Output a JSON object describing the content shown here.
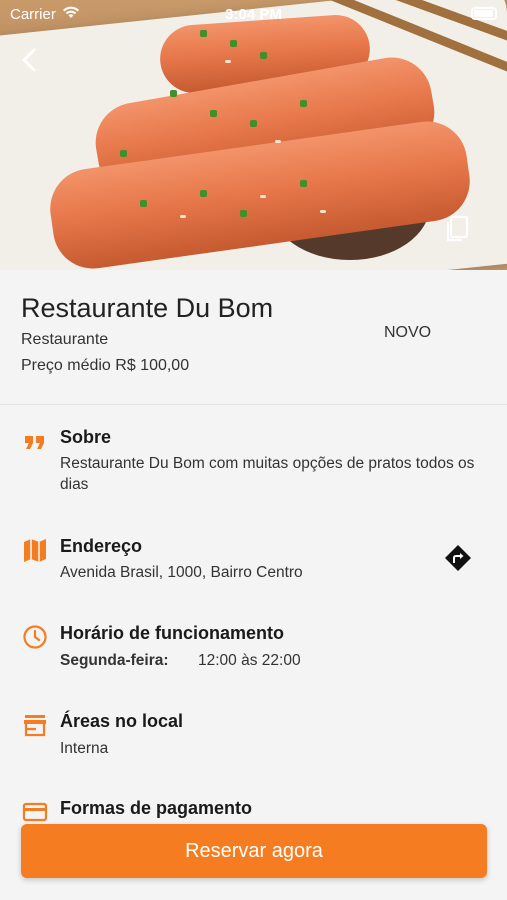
{
  "status_bar": {
    "carrier": "Carrier",
    "time": "3:04 PM"
  },
  "restaurant": {
    "name": "Restaurante Du Bom",
    "category": "Restaurante",
    "average_price": "Preço médio R$ 100,00",
    "badge": "NOVO"
  },
  "sections": {
    "about": {
      "title": "Sobre",
      "text": "Restaurante Du Bom com muitas opções de pratos todos os dias"
    },
    "address": {
      "title": "Endereço",
      "text": "Avenida Brasil, 1000, Bairro Centro"
    },
    "hours": {
      "title": "Horário de funcionamento",
      "day": "Segunda-feira:",
      "time": "12:00 às 22:00"
    },
    "areas": {
      "title": "Áreas no local",
      "text": "Interna"
    },
    "payment": {
      "title": "Formas de pagamento"
    }
  },
  "cta": {
    "label": "Reservar agora"
  },
  "icons": [
    "back-chevron-icon",
    "gallery-icon",
    "quote-icon",
    "map-icon",
    "directions-icon",
    "clock-icon",
    "store-icon",
    "credit-card-icon",
    "wifi-icon",
    "battery-icon"
  ],
  "colors": {
    "accent": "#f57c20",
    "background": "#f4f4f4"
  }
}
